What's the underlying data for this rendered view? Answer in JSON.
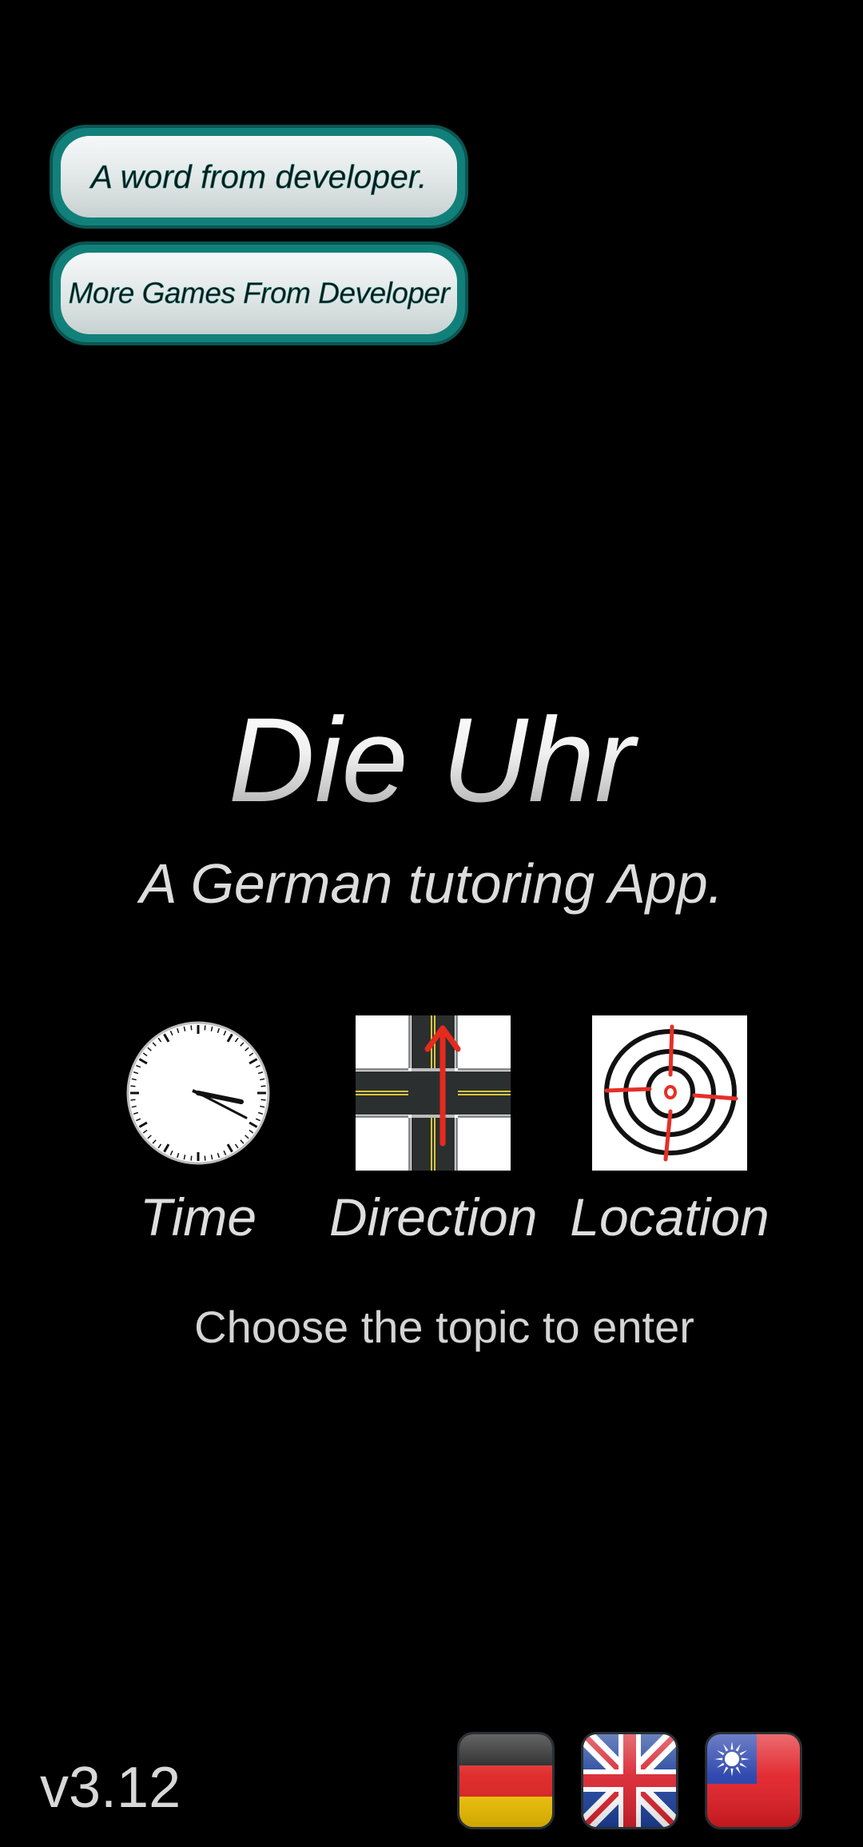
{
  "buttons": {
    "word_from_developer": "A word from developer.",
    "more_games": "More Games From Developer"
  },
  "app": {
    "title": "Die Uhr",
    "subtitle": "A German tutoring App."
  },
  "topics": [
    {
      "label": "Time",
      "icon": "clock-icon"
    },
    {
      "label": "Direction",
      "icon": "crossroad-arrow-icon"
    },
    {
      "label": "Location",
      "icon": "target-icon"
    }
  ],
  "hint": "Choose the topic to enter",
  "version": "v3.12",
  "languages": [
    {
      "icon": "germany-flag-icon"
    },
    {
      "icon": "uk-flag-icon"
    },
    {
      "icon": "taiwan-flag-icon"
    }
  ],
  "colors": {
    "background": "#000000",
    "button_frame": "#12807a",
    "arrow_red": "#e52b1e",
    "target_red": "#e53027"
  }
}
